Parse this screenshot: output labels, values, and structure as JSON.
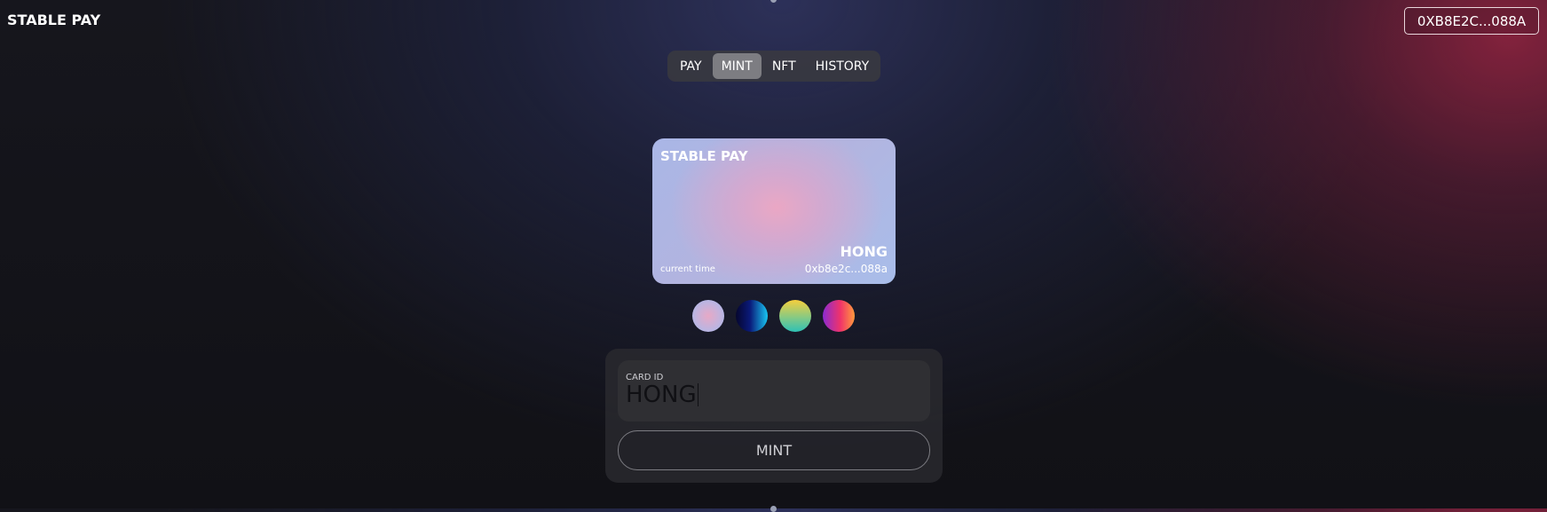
{
  "header": {
    "brand": "STABLE PAY",
    "wallet_address": "0XB8E2C...088A"
  },
  "tabs": [
    {
      "label": "PAY",
      "active": false
    },
    {
      "label": "MINT",
      "active": true
    },
    {
      "label": "NFT",
      "active": false
    },
    {
      "label": "HISTORY",
      "active": false
    }
  ],
  "card": {
    "title": "STABLE PAY",
    "name": "HONG",
    "time_label": "current time",
    "address": "0xb8e2c...088a"
  },
  "swatches": [
    {
      "name": "pastel-pink-blue",
      "colors": [
        "#e7a9c6",
        "#a9bce9"
      ]
    },
    {
      "name": "navy-cyan",
      "colors": [
        "#06062e",
        "#18c6f2"
      ]
    },
    {
      "name": "yellow-teal",
      "colors": [
        "#f6cf3d",
        "#2ec1b6"
      ]
    },
    {
      "name": "purple-pink-orange",
      "colors": [
        "#8b2bd1",
        "#ff9a3c"
      ]
    }
  ],
  "form": {
    "card_id_label": "CARD ID",
    "card_id_value": "HONG",
    "mint_button": "MINT"
  },
  "colors": {
    "active_tab": "#7d7d82",
    "accent_glow": "#962442"
  }
}
